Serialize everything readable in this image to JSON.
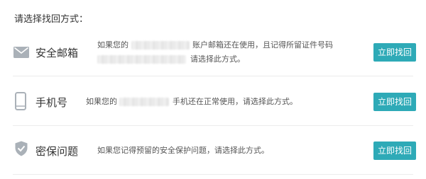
{
  "heading": "请选择找回方式：",
  "methods": [
    {
      "label": "安全邮箱",
      "desc_prefix": "如果您的",
      "desc_suffix": "账户邮箱还在使用，且记得所留证件号码",
      "desc_line2": "请选择此方式。",
      "button": "立即找回"
    },
    {
      "label": "手机号",
      "desc_prefix": "如果您的",
      "desc_suffix": "手机还在正常使用，请选择此方式。",
      "button": "立即找回"
    },
    {
      "label": "密保问题",
      "desc_full": "如果您记得预留的安全保护问题，请选择此方式。",
      "button": "立即找回"
    }
  ],
  "colors": {
    "accent": "#2eaab7",
    "icon": "#aab1b8",
    "divider": "#ececec"
  },
  "icons": [
    "mail-icon",
    "phone-icon",
    "shield-check-icon"
  ]
}
